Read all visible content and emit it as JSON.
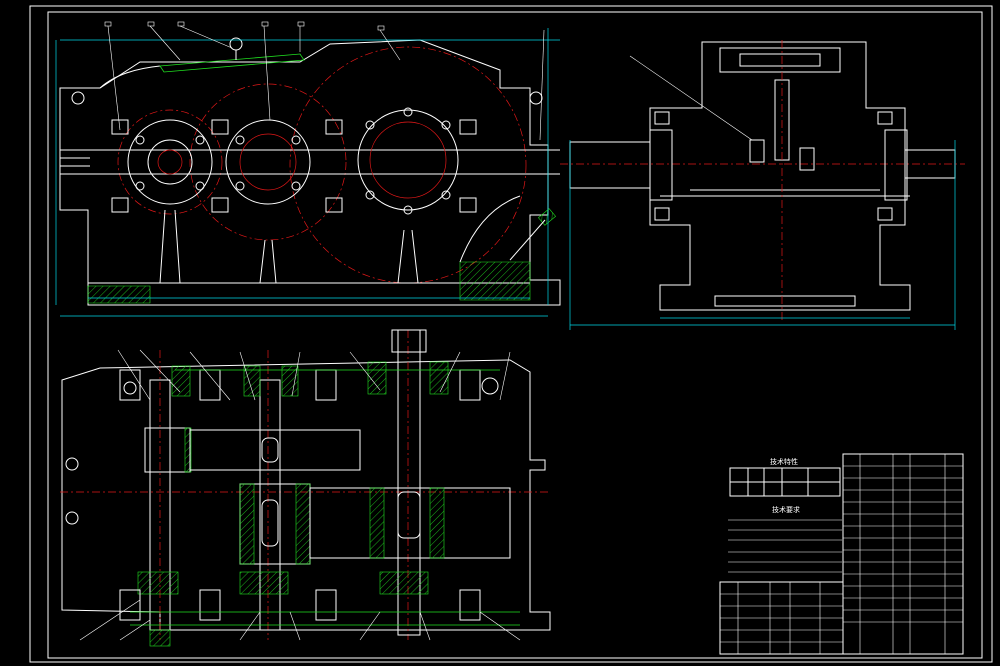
{
  "drawing": {
    "tech_table_title": "技术特性",
    "tech_req_title": "技术要求"
  },
  "colors": {
    "background": "#000000",
    "outline": "#ffffff",
    "dimension": "#00d8e8",
    "centerline": "#e01818",
    "hatch": "#20e020"
  }
}
